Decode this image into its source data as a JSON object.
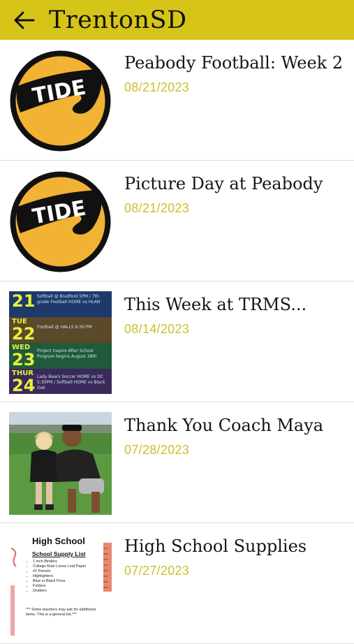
{
  "header": {
    "title": "TrentonSD",
    "back_icon": "arrow-left-icon",
    "background": "#d6c418"
  },
  "items": [
    {
      "title": "Peabody Football: Week 2",
      "date": "08/21/2023",
      "thumbnail": "tide-logo",
      "logo_text": "TIDE"
    },
    {
      "title": "Picture Day at Peabody",
      "date": "08/21/2023",
      "thumbnail": "tide-logo",
      "logo_text": "TIDE"
    },
    {
      "title": "This Week at TRMS...",
      "date": "08/14/2023",
      "thumbnail": "weekly-schedule-flyer",
      "flyer": {
        "days": [
          {
            "name": "",
            "num": "21",
            "note": "Softball @ Bradford 5PM / 7th grade Football HOME vs HLAN"
          },
          {
            "name": "TUE",
            "num": "22",
            "note": "Football @ HALLS 6:30 PM"
          },
          {
            "name": "WED",
            "num": "23",
            "note": "Project Inspire After School Program begins August 28th"
          },
          {
            "name": "THUR",
            "num": "24",
            "note": "Lady Bears Soccer HOME vs DC 5:30PM / Softball HOME vs Black Oak"
          }
        ]
      }
    },
    {
      "title": "Thank You Coach Maya",
      "date": "07/28/2023",
      "thumbnail": "coach-photo"
    },
    {
      "title": "High School Supplies",
      "date": "07/27/2023",
      "thumbnail": "supply-list",
      "supplies": {
        "heading": "High School",
        "subheading": "School Supply List",
        "list": [
          "1 inch Binders",
          "College Rule Loose Leaf Paper",
          "#2 Pencils",
          "Highlighters",
          "Blue or Black Pens",
          "Folders",
          "Dividers"
        ],
        "footnote": "*** Some teachers may ask for additional items. This is a general list.***"
      }
    }
  ],
  "colors": {
    "date": "#cdbf2c",
    "logo_yellow": "#f2b233",
    "divider": "#dcdcdc"
  }
}
